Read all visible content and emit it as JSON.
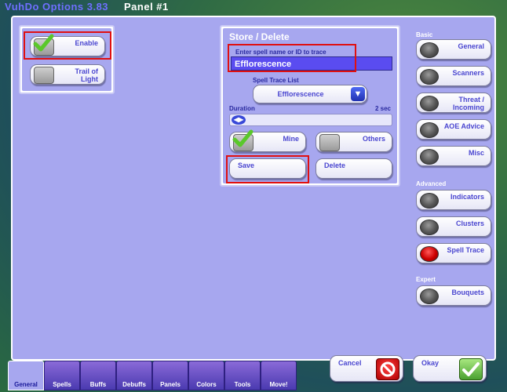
{
  "titlebar": {
    "app_title": "VuhDo Options 3.83",
    "panel_title": "Panel #1"
  },
  "enable_box": {
    "enable_label": "Enable",
    "enable_checked": true,
    "trail_label": "Trail of Light",
    "trail_checked": false
  },
  "store_box": {
    "title": "Store / Delete",
    "spell_name_label": "Enter spell name or ID to trace",
    "spell_name_value": "Efflorescence",
    "spell_trace_list_label": "Spell Trace List",
    "spell_trace_list_selected": "Efflorescence",
    "duration_label": "Duration",
    "duration_value": "2 sec",
    "mine_label": "Mine",
    "mine_checked": true,
    "others_label": "Others",
    "others_checked": false,
    "save_label": "Save",
    "delete_label": "Delete"
  },
  "right_panel": {
    "basic_label": "Basic",
    "basic_items": [
      {
        "label": "General"
      },
      {
        "label": "Scanners"
      },
      {
        "label": "Threat / Incoming"
      },
      {
        "label": "AOE Advice"
      },
      {
        "label": "Misc"
      }
    ],
    "advanced_label": "Advanced",
    "advanced_items": [
      {
        "label": "Indicators"
      },
      {
        "label": "Clusters"
      },
      {
        "label": "Spell Trace",
        "selected": true
      }
    ],
    "expert_label": "Expert",
    "expert_items": [
      {
        "label": "Bouquets"
      }
    ]
  },
  "bottom_buttons": {
    "cancel_label": "Cancel",
    "okay_label": "Okay"
  },
  "tabs": [
    {
      "label": "General",
      "active": true
    },
    {
      "label": "Spells"
    },
    {
      "label": "Buffs"
    },
    {
      "label": "Debuffs"
    },
    {
      "label": "Panels"
    },
    {
      "label": "Colors"
    },
    {
      "label": "Tools"
    },
    {
      "label": "Move!"
    }
  ],
  "colors": {
    "panel_bg": "#a7a7ef",
    "accent": "#4a46d0",
    "highlight_frame": "#e01010",
    "selected_radio": "#cc0000"
  },
  "icons": {
    "check": "checkmark-icon",
    "cancel": "no-entry-icon",
    "okay": "checkmark-icon",
    "dropdown": "down-arrow-icon",
    "slider": "left-right-arrows-icon"
  }
}
